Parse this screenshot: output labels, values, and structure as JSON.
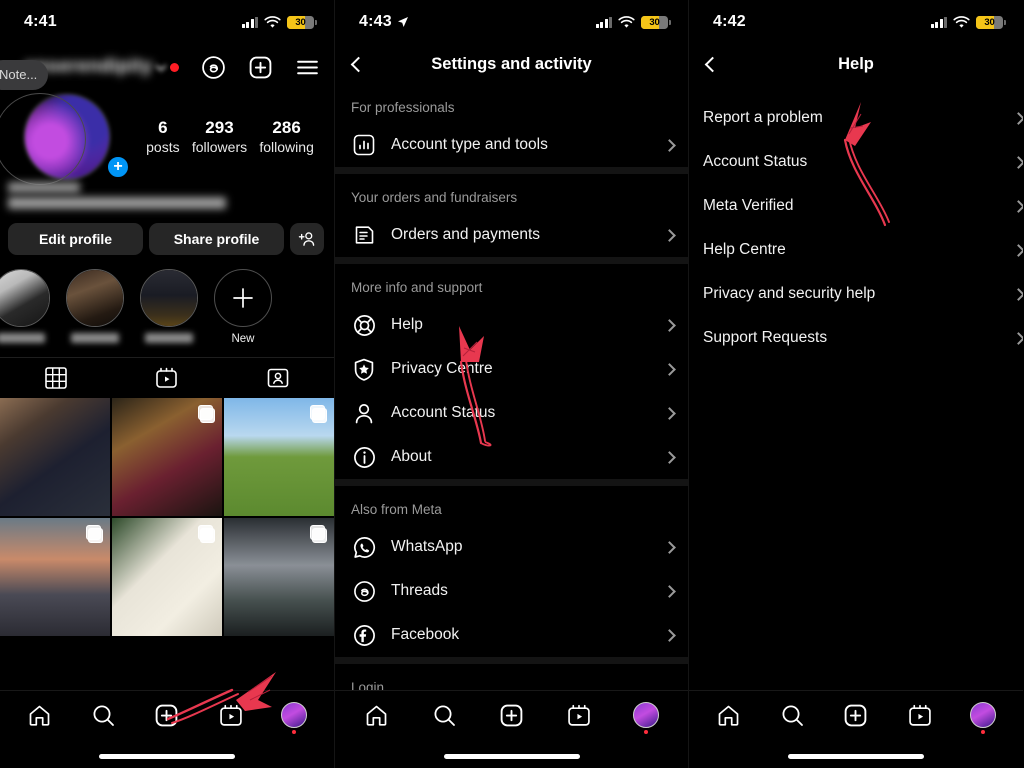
{
  "panels": {
    "profile": {
      "status": {
        "time": "4:41",
        "battery": "30"
      },
      "username": "onserendipity",
      "stats": [
        {
          "number": "6",
          "label": "posts"
        },
        {
          "number": "293",
          "label": "followers"
        },
        {
          "number": "286",
          "label": "following"
        }
      ],
      "note_bubble": "Note...",
      "buttons": {
        "edit": "Edit profile",
        "share": "Share profile",
        "add_person_icon": "add-person-icon"
      },
      "highlights": [
        {
          "label": "",
          "icon": "highlight-thumbnail"
        },
        {
          "label": "",
          "icon": "highlight-thumbnail"
        },
        {
          "label": "",
          "icon": "highlight-thumbnail"
        },
        {
          "label": "New",
          "icon": "plus-icon"
        }
      ],
      "tabs": [
        {
          "name": "grid-tab",
          "icon": "grid-icon"
        },
        {
          "name": "reels-tab",
          "icon": "reels-icon"
        },
        {
          "name": "tagged-tab",
          "icon": "tagged-icon"
        }
      ],
      "grid_posts": [
        {
          "multi": false
        },
        {
          "multi": true
        },
        {
          "multi": true
        },
        {
          "multi": true
        },
        {
          "multi": true
        },
        {
          "multi": true
        }
      ]
    },
    "settings": {
      "status": {
        "time": "4:43",
        "battery": "30",
        "location_icon": "location-arrow-icon"
      },
      "title": "Settings and activity",
      "sections": [
        {
          "heading": "For professionals",
          "items": [
            {
              "label": "Account type and tools",
              "icon": "chart-square-icon"
            }
          ]
        },
        {
          "heading": "Your orders and fundraisers",
          "items": [
            {
              "label": "Orders and payments",
              "icon": "receipt-icon"
            }
          ]
        },
        {
          "heading": "More info and support",
          "items": [
            {
              "label": "Help",
              "icon": "life-ring-icon"
            },
            {
              "label": "Privacy Centre",
              "icon": "shield-star-icon"
            },
            {
              "label": "Account Status",
              "icon": "person-icon"
            },
            {
              "label": "About",
              "icon": "info-circle-icon"
            }
          ]
        },
        {
          "heading": "Also from Meta",
          "items": [
            {
              "label": "WhatsApp",
              "icon": "whatsapp-icon"
            },
            {
              "label": "Threads",
              "icon": "threads-icon"
            },
            {
              "label": "Facebook",
              "icon": "facebook-icon"
            }
          ]
        },
        {
          "heading": "Login",
          "items": []
        }
      ]
    },
    "help": {
      "status": {
        "time": "4:42",
        "battery": "30"
      },
      "title": "Help",
      "items": [
        {
          "label": "Report a problem"
        },
        {
          "label": "Account Status"
        },
        {
          "label": "Meta Verified"
        },
        {
          "label": "Help Centre"
        },
        {
          "label": "Privacy and security help"
        },
        {
          "label": "Support Requests"
        }
      ]
    }
  },
  "tabbar": {
    "items": [
      {
        "name": "home-tab",
        "icon": "home-icon"
      },
      {
        "name": "search-tab",
        "icon": "search-icon"
      },
      {
        "name": "create-tab",
        "icon": "plus-square-icon"
      },
      {
        "name": "reels-tab",
        "icon": "reels-icon"
      },
      {
        "name": "profile-tab",
        "icon": "avatar-icon"
      }
    ]
  },
  "annotations": {
    "color": "#e8384f",
    "arrows": [
      {
        "panel": "profile",
        "points_to": "hamburger-menu-icon"
      },
      {
        "panel": "settings",
        "points_to": "Help"
      },
      {
        "panel": "help",
        "points_to": "Report a problem"
      }
    ]
  }
}
